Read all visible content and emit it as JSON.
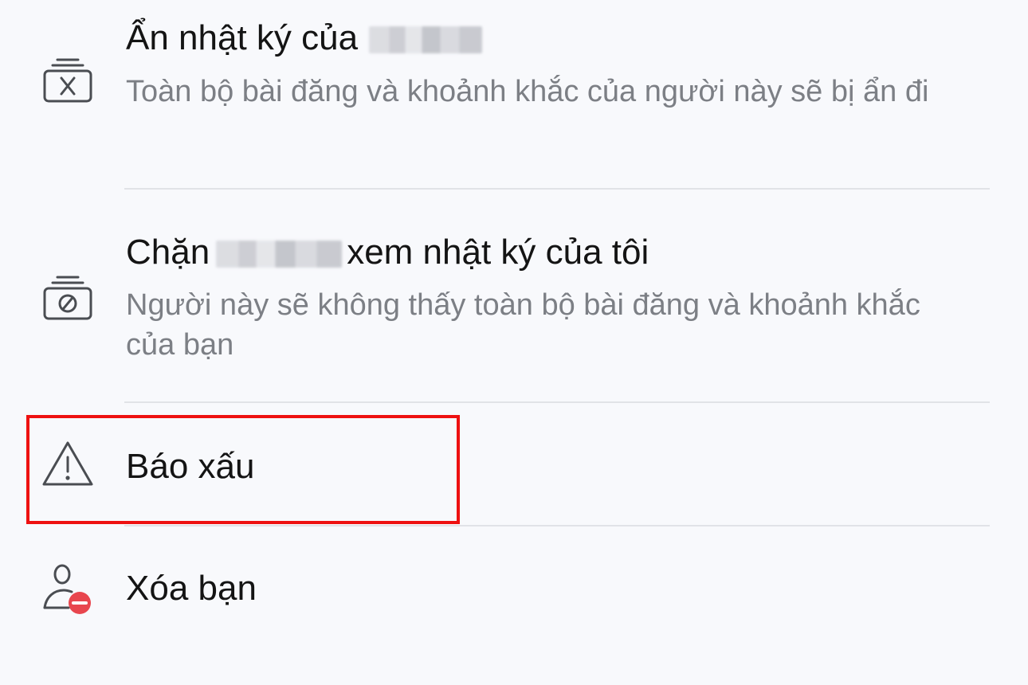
{
  "menu": {
    "hide_diary": {
      "title_prefix": "Ẩn nhật ký của",
      "description": "Toàn bộ bài đăng và khoảnh khắc của người này sẽ bị ẩn đi",
      "icon": "hide-feed-icon"
    },
    "block_viewing": {
      "title_prefix": "Chặn",
      "title_suffix": "xem nhật ký của tôi",
      "description": "Người này sẽ không thấy toàn bộ bài đăng và khoảnh khắc của bạn",
      "icon": "block-feed-icon"
    },
    "report": {
      "title": "Báo xấu",
      "icon": "warning-icon"
    },
    "unfriend": {
      "title": "Xóa bạn",
      "icon": "remove-friend-icon"
    }
  },
  "colors": {
    "highlight": "#ee1111",
    "remove_badge": "#e8464e",
    "icon_stroke": "#4a4d52"
  }
}
